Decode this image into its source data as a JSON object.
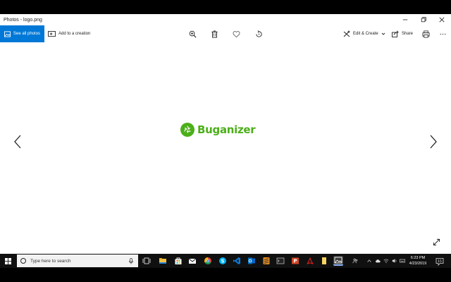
{
  "window": {
    "title": "Photos - logo.png"
  },
  "toolbar": {
    "see_all_label": "See all photos",
    "add_creation_label": "Add to a creation",
    "edit_create_label": "Edit & Create",
    "share_label": "Share"
  },
  "image": {
    "logo_text": "Buganizer",
    "logo_color": "#4caf19"
  },
  "taskbar": {
    "search_placeholder": "Type here to search",
    "clock_time": "6:23 PM",
    "clock_date": "4/23/2019",
    "notification_count": "15"
  },
  "colors": {
    "accent": "#0078d7",
    "taskbar_bg": "#101010"
  }
}
